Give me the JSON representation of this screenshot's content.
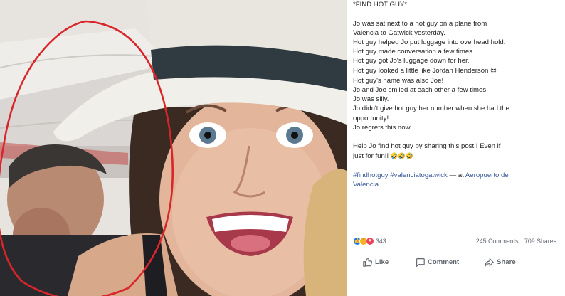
{
  "post": {
    "lines": [
      "*FIND HOT GUY*",
      "",
      "Jo was sat next to a hot guy on a plane from",
      "Valencia to Gatwick yesterday.",
      "Hot guy helped Jo put luggage into overhead hold.",
      "Hot guy made conversation a few times.",
      "Hot guy got Jo's luggage down for her.",
      "Hot guy looked a little like Jordan Henderson",
      "Hot guy's name was also Joe!",
      "Jo and Joe smiled at each other a few times.",
      "Jo was silly.",
      "Jo didn't give hot guy her number when she had the",
      "opportunity!",
      "Jo regrets this now.",
      "",
      "Help Jo find hot guy by sharing this post!! Even if",
      "just for fun!!"
    ],
    "emoji_heart_eyes": "😍",
    "emoji_laughing": "🤣🤣🤣",
    "hashtag_1": "#findhotguy",
    "hashtag_2": "#valenciatogatwick",
    "location_sep": "— at",
    "location_1": "Aeropuerto de",
    "location_2": "Valencia."
  },
  "reactions": {
    "icons": [
      "like-reaction",
      "haha-reaction",
      "love-reaction"
    ],
    "count": "343",
    "comments": "245 Comments",
    "shares": "709 Shares"
  },
  "actions": {
    "like": "Like",
    "comment": "Comment",
    "share": "Share"
  },
  "colors": {
    "link": "#385898",
    "like_blue": "#1877f2",
    "annotation_circle": "#d8262a",
    "hat_band": "#2f3a41"
  }
}
